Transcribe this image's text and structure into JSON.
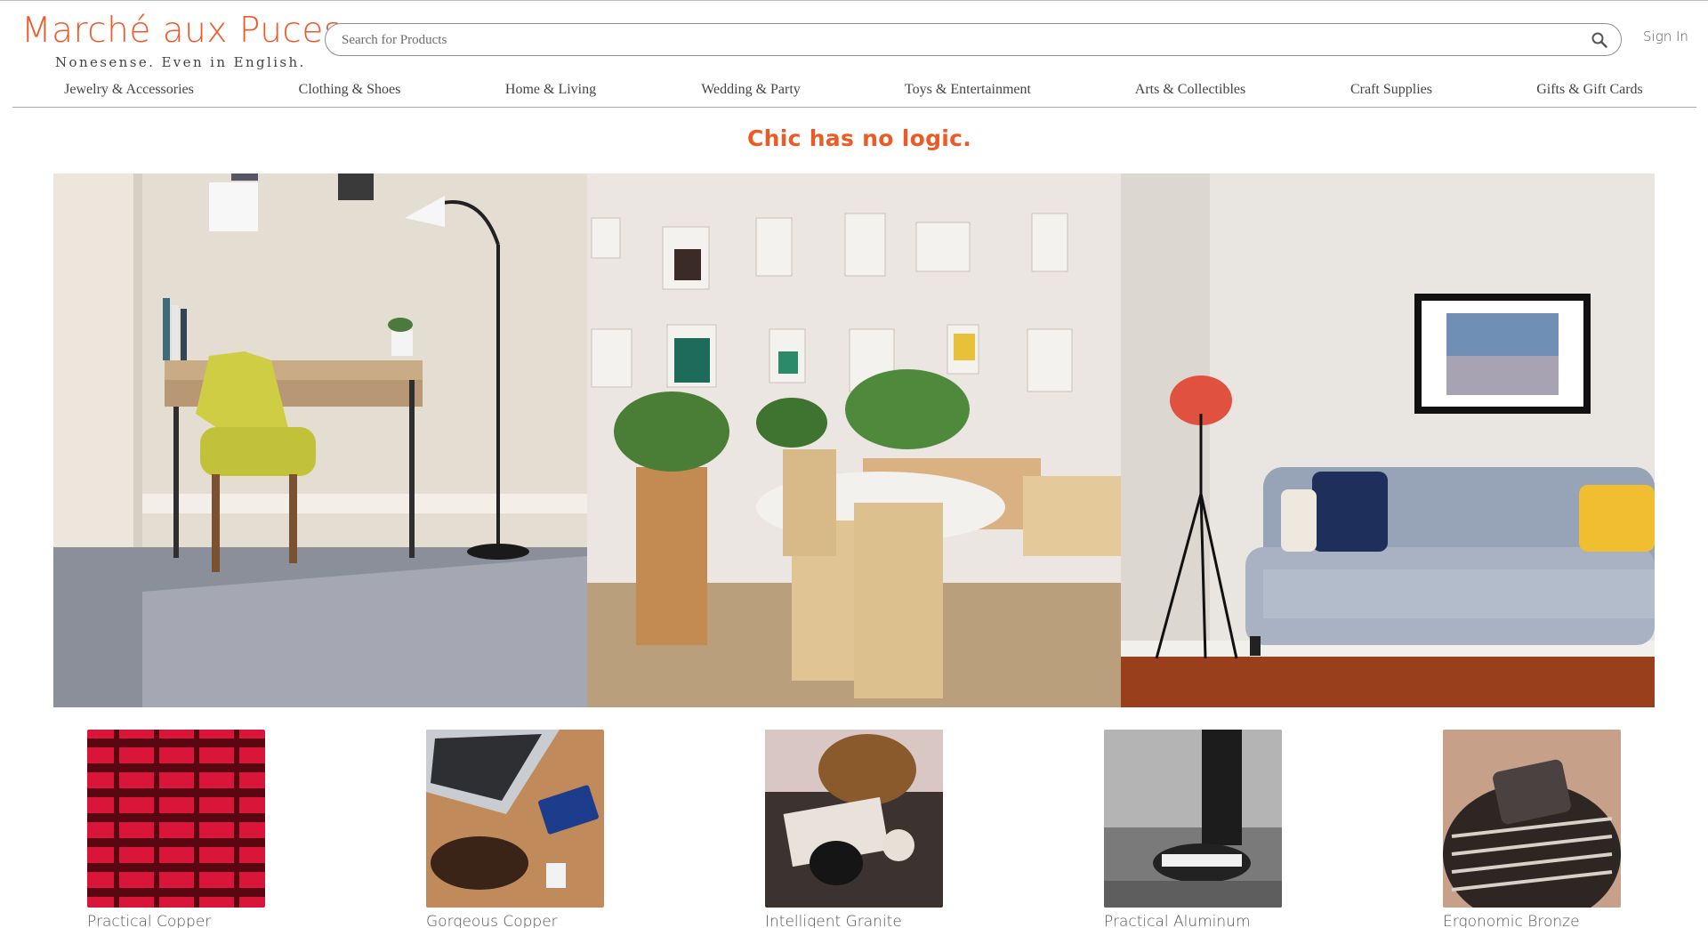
{
  "header": {
    "logo": "Marché aux Puces",
    "tagline": "Nonesense. Even in English.",
    "search_placeholder": "Search for Products",
    "sign_in": "Sign In"
  },
  "nav": {
    "items": [
      {
        "label": "Jewelry & Accessories"
      },
      {
        "label": "Clothing & Shoes"
      },
      {
        "label": "Home & Living"
      },
      {
        "label": "Wedding & Party"
      },
      {
        "label": "Toys & Entertainment"
      },
      {
        "label": "Arts & Collectibles"
      },
      {
        "label": "Craft Supplies"
      },
      {
        "label": "Gifts & Gift Cards"
      }
    ]
  },
  "hero": {
    "headline": "Chic has no logic."
  },
  "products": [
    {
      "name": "Practical Copper"
    },
    {
      "name": "Gorgeous Copper"
    },
    {
      "name": "Intelligent Granite"
    },
    {
      "name": "Practical Aluminum"
    },
    {
      "name": "Ergonomic Bronze"
    }
  ],
  "colors": {
    "brand": "#f0592a",
    "headline": "#ee5a24"
  }
}
